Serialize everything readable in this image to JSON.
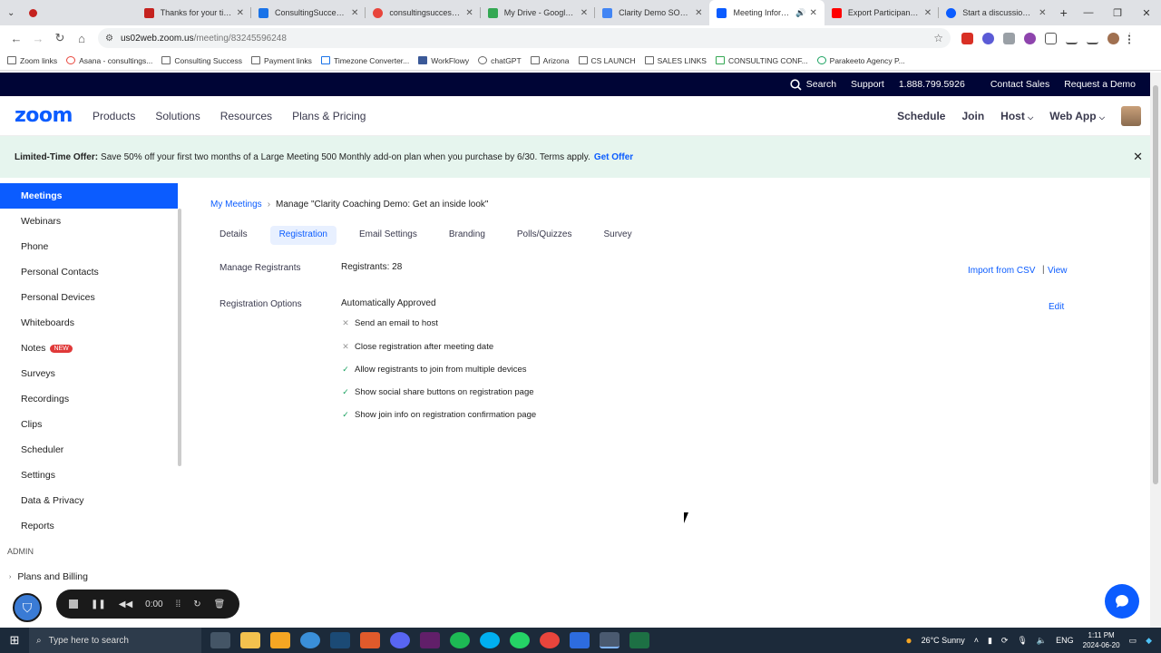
{
  "browser": {
    "tabs": [
      {
        "title": "Thanks for your time to",
        "color": "#c5221f"
      },
      {
        "title": "ConsultingSuccess.com",
        "color": "#1a73e8"
      },
      {
        "title": "consultingsuccess.com",
        "color": "#e8453c"
      },
      {
        "title": "My Drive - Google Drive",
        "color": "#34a853"
      },
      {
        "title": "Clarity Demo SOP worki",
        "color": "#4285f4"
      },
      {
        "title": "Meeting Information",
        "color": "#0b5cff",
        "active": true
      },
      {
        "title": "Export Participant List fr",
        "color": "#ff0000"
      },
      {
        "title": "Start a discussion - Zoo",
        "color": "#0b5cff"
      }
    ],
    "url_domain": "us02web.zoom.us",
    "url_path": "/meeting/83245596248",
    "bookmarks": [
      "Zoom links",
      "Asana - consultings...",
      "Consulting Success",
      "Payment links",
      "Timezone Converter...",
      "WorkFlowy",
      "chatGPT",
      "Arizona",
      "CS LAUNCH",
      "SALES LINKS",
      "CONSULTING CONF...",
      "Parakeeto Agency P..."
    ]
  },
  "topbar": {
    "search": "Search",
    "support": "Support",
    "phone": "1.888.799.5926",
    "contact": "Contact Sales",
    "demo": "Request a Demo"
  },
  "nav": {
    "logo": "zoom",
    "menu": [
      "Products",
      "Solutions",
      "Resources",
      "Plans & Pricing"
    ],
    "right": {
      "schedule": "Schedule",
      "join": "Join",
      "host": "Host",
      "webapp": "Web App"
    }
  },
  "banner": {
    "lead": "Limited-Time Offer:",
    "text": "Save 50% off your first two months of a Large Meeting 500 Monthly add-on plan when you purchase by 6/30. Terms apply.",
    "link": "Get Offer"
  },
  "sidebar": {
    "items": [
      "Meetings",
      "Webinars",
      "Phone",
      "Personal Contacts",
      "Personal Devices",
      "Whiteboards",
      "Notes",
      "Surveys",
      "Recordings",
      "Clips",
      "Scheduler",
      "Settings",
      "Data & Privacy",
      "Reports"
    ],
    "new_badge": "NEW",
    "admin": "ADMIN",
    "plans": "Plans and Billing"
  },
  "main": {
    "breadcrumb_link": "My Meetings",
    "breadcrumb_current": "Manage \"Clarity Coaching Demo: Get an inside look\"",
    "tabs": [
      "Details",
      "Registration",
      "Email Settings",
      "Branding",
      "Polls/Quizzes",
      "Survey"
    ],
    "manage_label": "Manage Registrants",
    "registrants": "Registrants: 28",
    "import": "Import from CSV",
    "view": "View",
    "options_label": "Registration Options",
    "approval": "Automatically Approved",
    "edit": "Edit",
    "options": [
      {
        "text": "Send an email to host",
        "on": false
      },
      {
        "text": "Close registration after meeting date",
        "on": false
      },
      {
        "text": "Allow registrants to join from multiple devices",
        "on": true
      },
      {
        "text": "Show social share buttons on registration page",
        "on": true
      },
      {
        "text": "Show join info on registration confirmation page",
        "on": true
      }
    ]
  },
  "recorder": {
    "time": "0:00"
  },
  "taskbar": {
    "search": "Type here to search",
    "weather": "26°C  Sunny",
    "lang": "ENG",
    "time": "1:11 PM",
    "date": "2024-06-20"
  }
}
